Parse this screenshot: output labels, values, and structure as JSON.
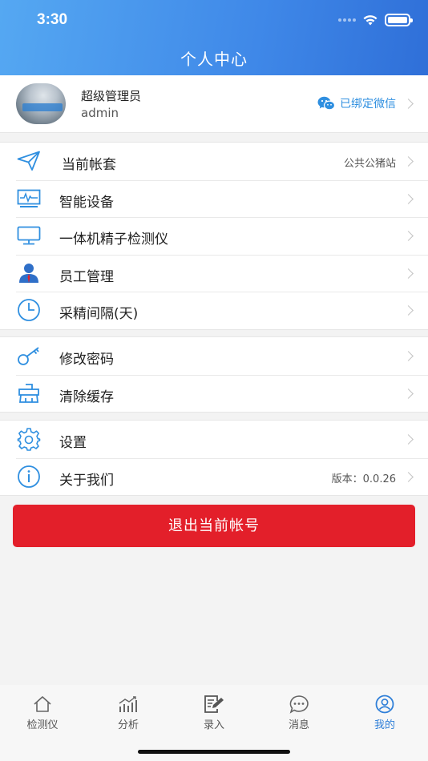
{
  "status_bar": {
    "time": "3:30"
  },
  "header": {
    "title": "个人中心"
  },
  "profile": {
    "name": "超级管理员",
    "username": "admin",
    "wechat_label": "已绑定微信",
    "wechat_icon": "wechat-icon"
  },
  "groups": [
    {
      "rows": [
        {
          "label": "当前帐套",
          "value": "公共公猪站",
          "icon": "paper-plane-icon"
        },
        {
          "label": "智能设备",
          "value": "",
          "icon": "monitor-wave-icon"
        },
        {
          "label": "一体机精子检测仪",
          "value": "",
          "icon": "desktop-icon"
        },
        {
          "label": "员工管理",
          "value": "",
          "icon": "staff-icon"
        },
        {
          "label": "采精间隔(天)",
          "value": "",
          "icon": "clock-icon"
        }
      ]
    },
    {
      "rows": [
        {
          "label": "修改密码",
          "value": "",
          "icon": "key-icon"
        },
        {
          "label": "清除缓存",
          "value": "",
          "icon": "broom-icon"
        }
      ]
    },
    {
      "rows": [
        {
          "label": "设置",
          "value": "",
          "icon": "gear-icon"
        },
        {
          "label": "关于我们",
          "value": "版本：0.0.26",
          "icon": "info-icon"
        }
      ]
    }
  ],
  "logout_label": "退出当前帐号",
  "tabs": [
    {
      "label": "检测仪",
      "icon": "home-icon",
      "active": false
    },
    {
      "label": "分析",
      "icon": "chart-icon",
      "active": false
    },
    {
      "label": "录入",
      "icon": "edit-icon",
      "active": false
    },
    {
      "label": "消息",
      "icon": "chat-icon",
      "active": false
    },
    {
      "label": "我的",
      "icon": "user-icon",
      "active": true
    }
  ],
  "colors": {
    "header_start": "#55a8f2",
    "header_end": "#2f6fd8",
    "accent": "#2f7fd8",
    "logout": "#e31f2a",
    "icon_blue": "#2f8fe0"
  }
}
